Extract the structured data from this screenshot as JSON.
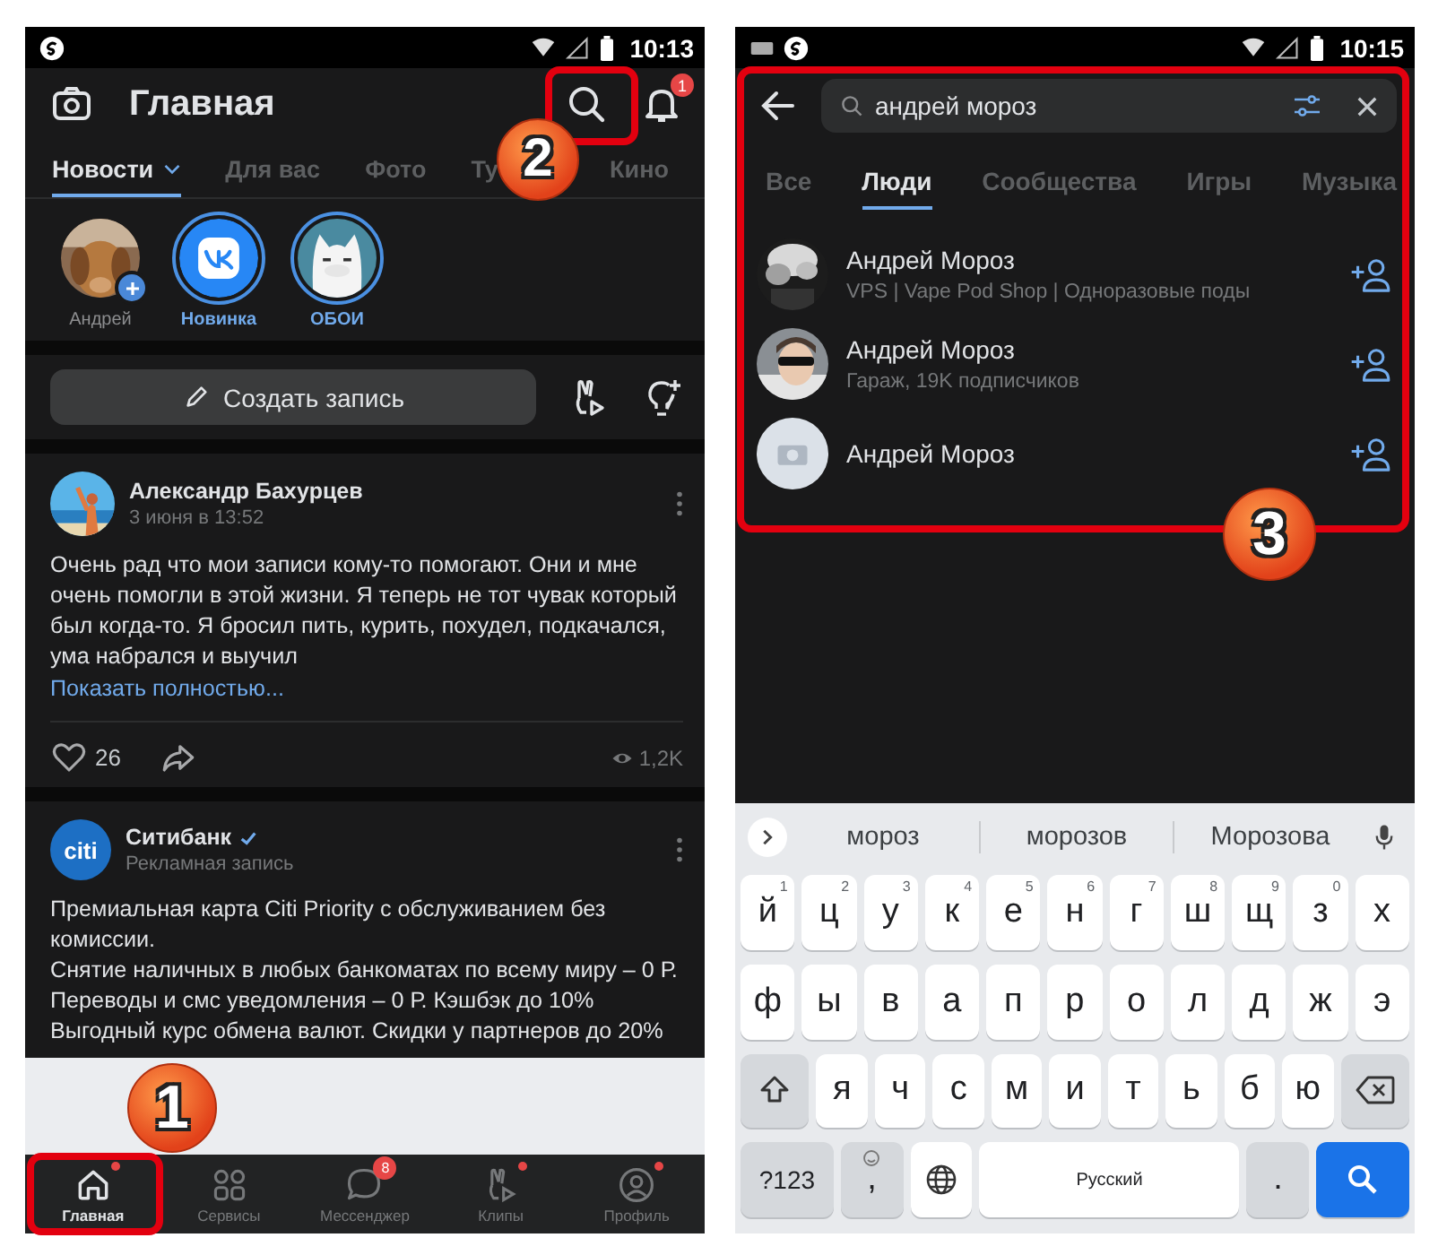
{
  "annotations": [
    {
      "number": "1"
    },
    {
      "number": "2"
    },
    {
      "number": "3"
    }
  ],
  "left_screen": {
    "status_bar": {
      "time": "10:13"
    },
    "header": {
      "title": "Главная",
      "notification_badge": "1"
    },
    "tabs": [
      {
        "label": "Новости",
        "selected": true,
        "dropdown": true
      },
      {
        "label": "Для вас",
        "selected": false,
        "dropdown": false
      },
      {
        "label": "Фото",
        "selected": false,
        "dropdown": false
      },
      {
        "label": "Ту",
        "selected": false,
        "dropdown": false
      },
      {
        "label": "Кино",
        "selected": false,
        "dropdown": false
      }
    ],
    "stories": [
      {
        "name": "Андрей",
        "unseen": false,
        "add_button": true
      },
      {
        "name": "Новинка",
        "unseen": true,
        "add_button": false
      },
      {
        "name": "ОБОИ",
        "unseen": true,
        "add_button": false
      }
    ],
    "create_post": {
      "label": "Создать запись"
    },
    "posts": [
      {
        "author": "Александр Бахурцев",
        "verified": false,
        "subtitle": "3 июня в 13:52",
        "text": [
          "Очень рад что мои записи кому-то помогают. Они и мне очень помогли в этой жизни. Я теперь не тот чувак который был когда-то. Я бросил пить, курить, похудел, подкачался, ума набрался и выучил"
        ],
        "more_link": "Показать полностью...",
        "likes": "26",
        "views": "1,2K"
      },
      {
        "author": "Ситибанк",
        "verified": true,
        "logo_text": "citi",
        "subtitle": "Рекламная запись",
        "text": [
          "Премиальная карта Citi Priority с обслуживанием без комиссии.",
          "Снятие наличных в любых банкоматах по всему миру – 0 Р. Переводы и смс уведомления – 0 Р. Кэшбэк до 10%",
          "Выгодный курс обмена валют. Скидки у партнеров до 20%"
        ]
      }
    ],
    "bottom_nav": [
      {
        "label": "Главная",
        "selected": true,
        "dot": true
      },
      {
        "label": "Сервисы",
        "selected": false,
        "dot": false
      },
      {
        "label": "Мессенджер",
        "selected": false,
        "dot": false,
        "badge": "8"
      },
      {
        "label": "Клипы",
        "selected": false,
        "dot": true
      },
      {
        "label": "Профиль",
        "selected": false,
        "dot": true
      }
    ]
  },
  "right_screen": {
    "status_bar": {
      "time": "10:15"
    },
    "search": {
      "value": "андрей мороз"
    },
    "tabs": [
      {
        "label": "Все",
        "selected": false
      },
      {
        "label": "Люди",
        "selected": true
      },
      {
        "label": "Сообщества",
        "selected": false
      },
      {
        "label": "Игры",
        "selected": false
      },
      {
        "label": "Музыка",
        "selected": false
      }
    ],
    "results": [
      {
        "name": "Андрей Мороз",
        "subtitle": "VPS | Vape Pod Shop | Одноразовые поды",
        "photo": true
      },
      {
        "name": "Андрей Мороз",
        "subtitle": "Гараж, 19K подписчиков",
        "photo": true
      },
      {
        "name": "Андрей Мороз",
        "photo": false
      }
    ],
    "keyboard": {
      "suggestions": [
        "мороз",
        "морозов",
        "Морозова"
      ],
      "key_rows": [
        {
          "keys": [
            {
              "kind": "char",
              "label": "й",
              "hint": "1"
            },
            {
              "kind": "char",
              "label": "ц",
              "hint": "2"
            },
            {
              "kind": "char",
              "label": "у",
              "hint": "3"
            },
            {
              "kind": "char",
              "label": "к",
              "hint": "4"
            },
            {
              "kind": "char",
              "label": "е",
              "hint": "5"
            },
            {
              "kind": "char",
              "label": "н",
              "hint": "6"
            },
            {
              "kind": "char",
              "label": "г",
              "hint": "7"
            },
            {
              "kind": "char",
              "label": "ш",
              "hint": "8"
            },
            {
              "kind": "char",
              "label": "щ",
              "hint": "9"
            },
            {
              "kind": "char",
              "label": "з",
              "hint": "0"
            },
            {
              "kind": "char",
              "label": "х"
            }
          ]
        },
        {
          "keys": [
            {
              "kind": "char",
              "label": "ф"
            },
            {
              "kind": "char",
              "label": "ы"
            },
            {
              "kind": "char",
              "label": "в"
            },
            {
              "kind": "char",
              "label": "а"
            },
            {
              "kind": "char",
              "label": "п"
            },
            {
              "kind": "char",
              "label": "р"
            },
            {
              "kind": "char",
              "label": "о"
            },
            {
              "kind": "char",
              "label": "л"
            },
            {
              "kind": "char",
              "label": "д"
            },
            {
              "kind": "char",
              "label": "ж"
            },
            {
              "kind": "char",
              "label": "э"
            }
          ]
        },
        {
          "keys": [
            {
              "kind": "shift"
            },
            {
              "kind": "char",
              "label": "я"
            },
            {
              "kind": "char",
              "label": "ч"
            },
            {
              "kind": "char",
              "label": "с"
            },
            {
              "kind": "char",
              "label": "м"
            },
            {
              "kind": "char",
              "label": "и"
            },
            {
              "kind": "char",
              "label": "т"
            },
            {
              "kind": "char",
              "label": "ь"
            },
            {
              "kind": "char",
              "label": "б"
            },
            {
              "kind": "char",
              "label": "ю"
            },
            {
              "kind": "backspace"
            }
          ]
        },
        {
          "keys": [
            {
              "kind": "symbols",
              "label": "?123"
            },
            {
              "kind": "comma",
              "label": ","
            },
            {
              "kind": "globe"
            },
            {
              "kind": "space",
              "label": "Русский"
            },
            {
              "kind": "period",
              "label": "."
            },
            {
              "kind": "action"
            }
          ]
        }
      ]
    }
  }
}
